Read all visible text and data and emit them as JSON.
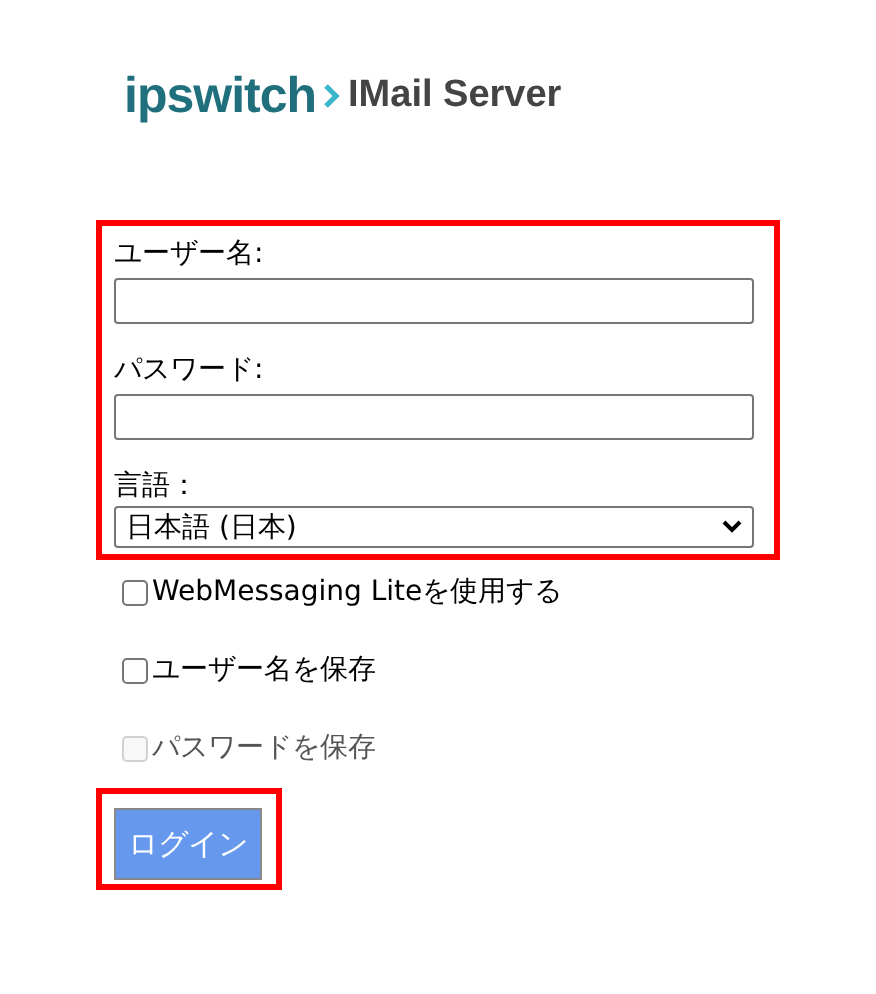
{
  "logo": {
    "brand": "ipswitch",
    "product": "IMail Server"
  },
  "fields": [
    {
      "label": "ユーザー名:",
      "kind": "text"
    },
    {
      "label": "パスワード:",
      "kind": "password"
    },
    {
      "label": "言語：",
      "kind": "select",
      "value": "日本語 (日本)"
    }
  ],
  "options": [
    {
      "label": "WebMessaging Liteを使用する",
      "checked": false,
      "disabled": false
    },
    {
      "label": "ユーザー名を保存",
      "checked": false,
      "disabled": false
    },
    {
      "label": "パスワードを保存",
      "checked": false,
      "disabled": true
    }
  ],
  "login_button": "ログイン"
}
